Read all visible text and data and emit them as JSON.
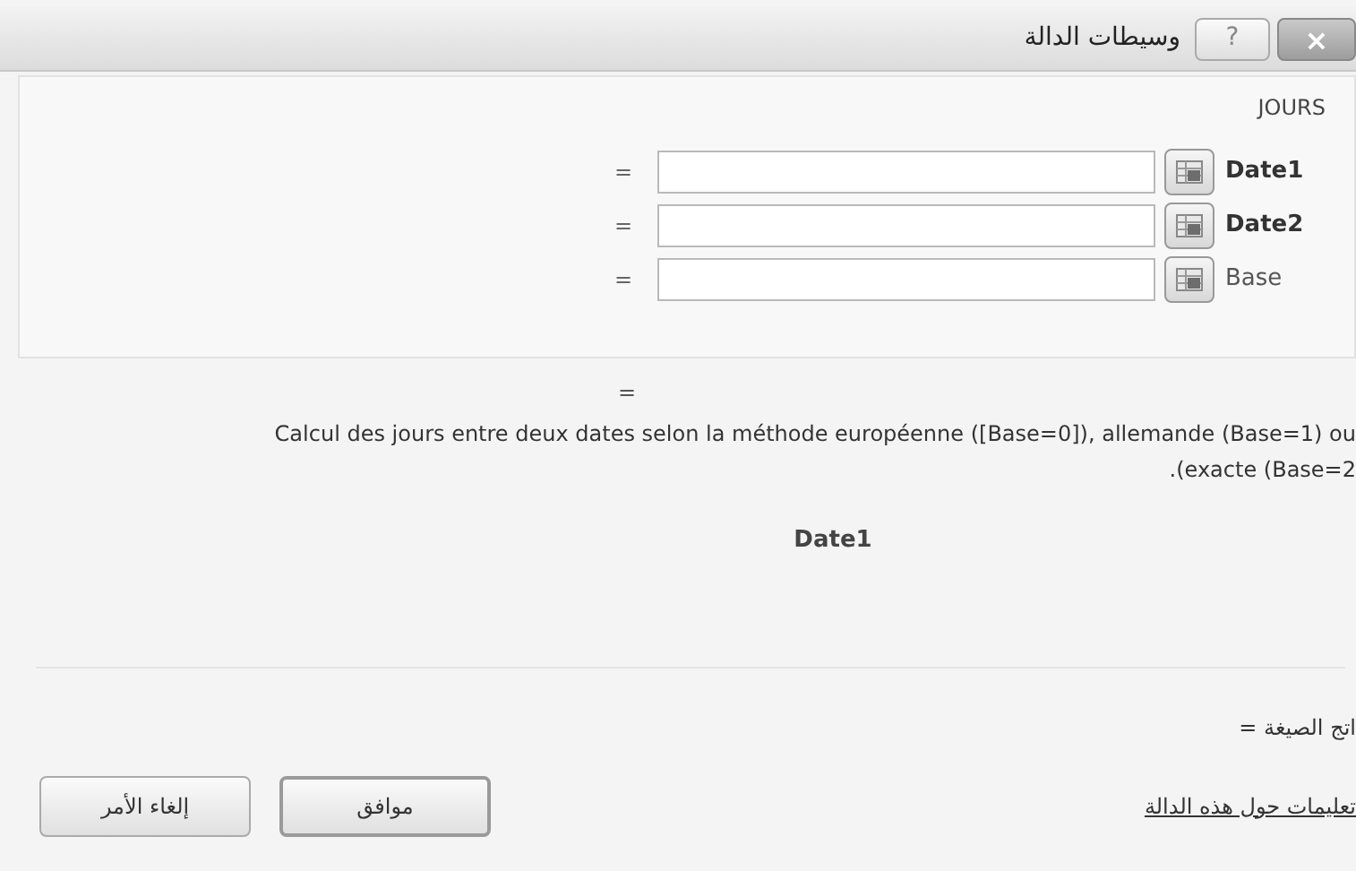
{
  "window": {
    "title": "وسيطات الدالة",
    "help": "?",
    "close": "×"
  },
  "function": {
    "name": "JOURS",
    "arguments": [
      {
        "label": "Date1",
        "required": true,
        "equals": "="
      },
      {
        "label": "Date2",
        "required": true,
        "equals": "="
      },
      {
        "label": "Base",
        "required": false,
        "equals": "="
      }
    ],
    "result_equals": "=",
    "description": [
      "Calcul des jours entre deux dates selon la méthode européenne ([Base=0]), allemande (Base=1) ou",
      ".(exacte (Base=2"
    ],
    "argument_name": "Date1"
  },
  "formula_result": "اتج الصيغة =",
  "help_link": "تعليمات حول هذه الدالة",
  "buttons": [
    {
      "label": "موافق",
      "default": true
    },
    {
      "label": "إلغاء الأمر",
      "default": false
    }
  ]
}
